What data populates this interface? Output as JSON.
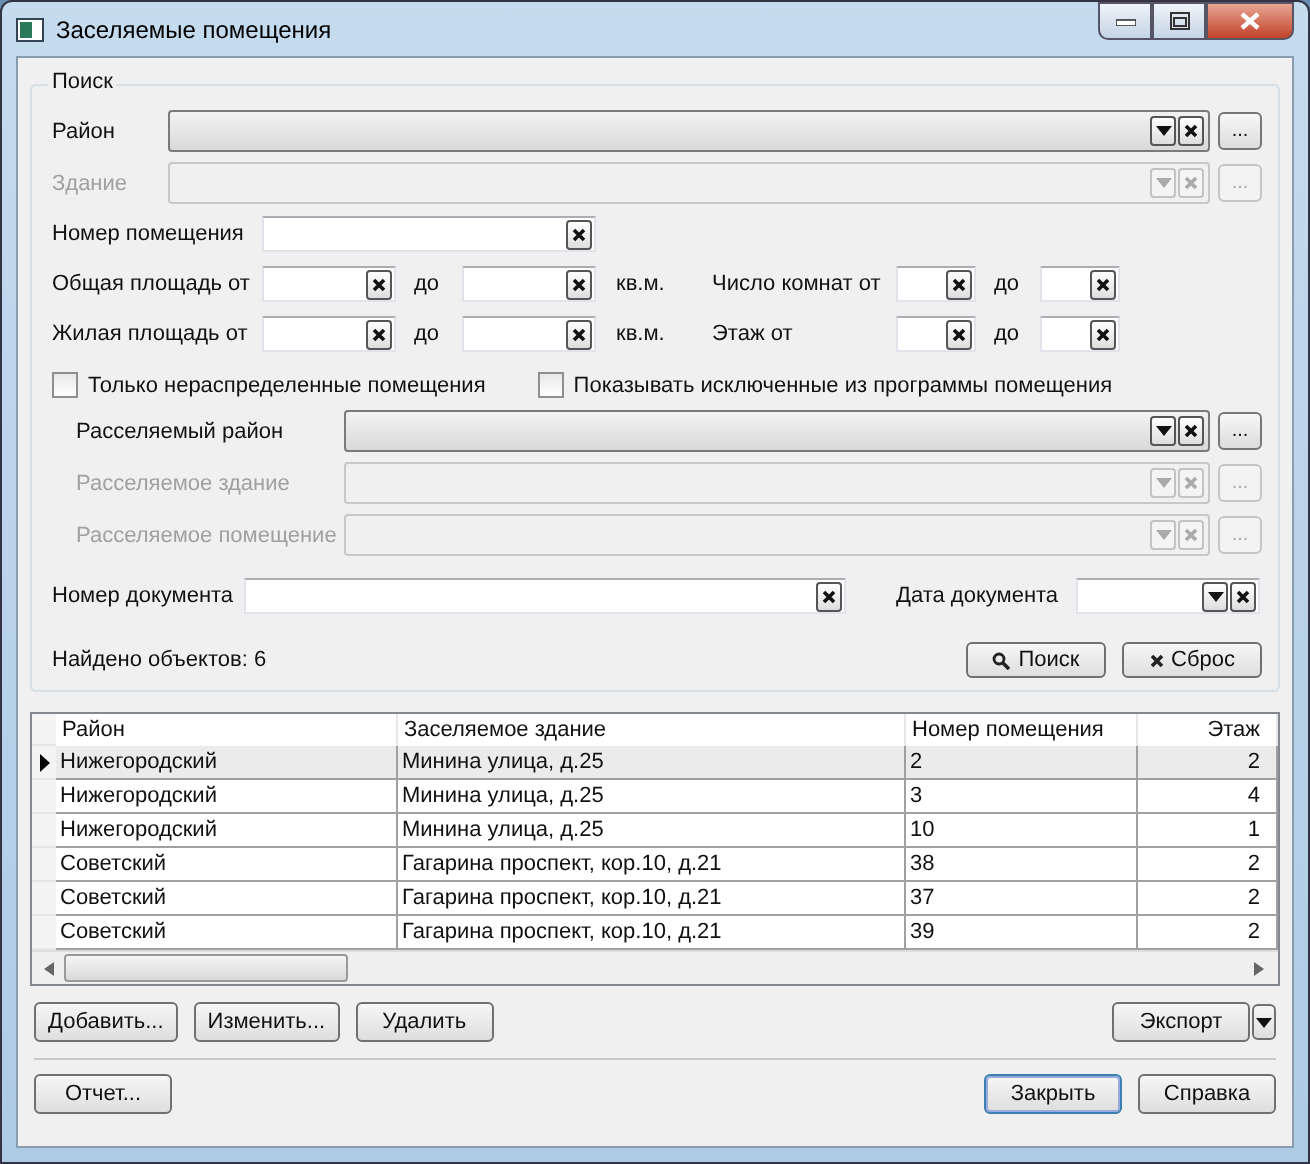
{
  "window": {
    "title": "Заселяемые помещения"
  },
  "search": {
    "title": "Поиск",
    "selectors": [
      {
        "label": "Район",
        "disabled": false,
        "browse": "..."
      },
      {
        "label": "Здание",
        "disabled": true,
        "browse": "..."
      }
    ],
    "room_number": {
      "label": "Номер помещения"
    },
    "ranges": [
      {
        "label": "Общая площадь от",
        "to": "до",
        "unit": "кв.м.",
        "right_label": "Число комнат от",
        "right_to": "до"
      },
      {
        "label": "Жилая площадь от",
        "to": "до",
        "unit": "кв.м.",
        "right_label": "Этаж от",
        "right_to": "до"
      }
    ],
    "checkboxes": [
      {
        "label": "Только нераспределенные помещения",
        "checked": false
      },
      {
        "label": "Показывать исключенные из программы помещения",
        "checked": false
      }
    ],
    "resettle_selectors": [
      {
        "label": "Расселяемый район",
        "disabled": false,
        "browse": "..."
      },
      {
        "label": "Расселяемое здание",
        "disabled": true,
        "browse": "..."
      },
      {
        "label": "Расселяемое помещение",
        "disabled": true,
        "browse": "..."
      }
    ],
    "document_number": {
      "label": "Номер документа"
    },
    "document_date": {
      "label": "Дата документа"
    },
    "found": "Найдено объектов: 6",
    "buttons": [
      {
        "label": "Поиск",
        "kind": "search"
      },
      {
        "label": "Сброс",
        "kind": "reset"
      }
    ]
  },
  "table": {
    "columns": [
      {
        "label": "Район"
      },
      {
        "label": "Заселяемое здание"
      },
      {
        "label": "Номер помещения"
      },
      {
        "label": "Этаж"
      }
    ],
    "rows": [
      {
        "cells": [
          "Нижегородский",
          "Минина улица, д.25",
          "2",
          "2"
        ],
        "selected": true
      },
      {
        "cells": [
          "Нижегородский",
          "Минина улица, д.25",
          "3",
          "4"
        ],
        "selected": false
      },
      {
        "cells": [
          "Нижегородский",
          "Минина улица, д.25",
          "10",
          "1"
        ],
        "selected": false
      },
      {
        "cells": [
          "Советский",
          "Гагарина  проспект, кор.10, д.21",
          "38",
          "2"
        ],
        "selected": false
      },
      {
        "cells": [
          "Советский",
          "Гагарина  проспект, кор.10, д.21",
          "37",
          "2"
        ],
        "selected": false
      },
      {
        "cells": [
          "Советский",
          "Гагарина  проспект, кор.10, д.21",
          "39",
          "2"
        ],
        "selected": false
      }
    ]
  },
  "actions": [
    {
      "label": "Добавить..."
    },
    {
      "label": "Изменить..."
    },
    {
      "label": "Удалить"
    }
  ],
  "export": {
    "label": "Экспорт"
  },
  "footer": {
    "left": [
      {
        "label": "Отчет...",
        "default": false
      }
    ],
    "right": [
      {
        "label": "Закрыть",
        "default": true
      },
      {
        "label": "Справка",
        "default": false
      }
    ]
  }
}
